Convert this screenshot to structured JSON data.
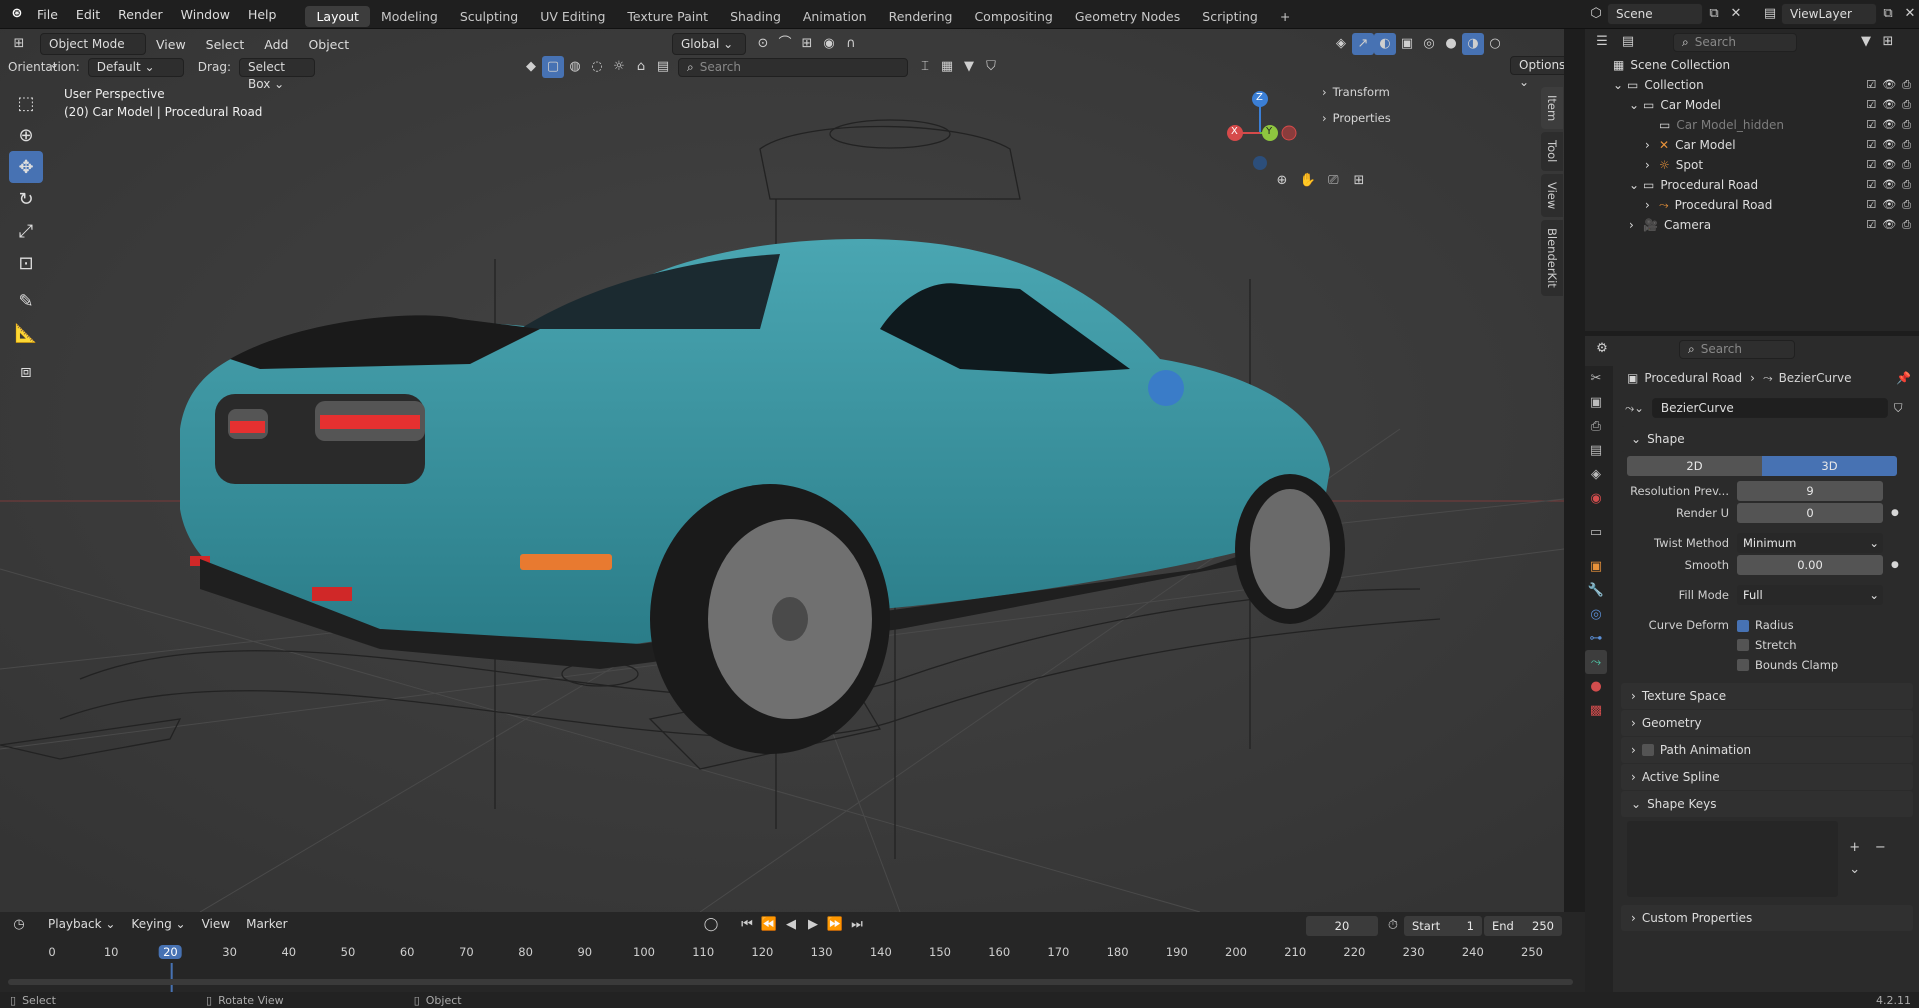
{
  "app": {
    "menus": [
      "File",
      "Edit",
      "Render",
      "Window",
      "Help"
    ],
    "workspaces": [
      "Layout",
      "Modeling",
      "Sculpting",
      "UV Editing",
      "Texture Paint",
      "Shading",
      "Animation",
      "Rendering",
      "Compositing",
      "Geometry Nodes",
      "Scripting"
    ],
    "active_workspace": "Layout",
    "scene": "Scene",
    "view_layer": "ViewLayer",
    "version": "4.2.11"
  },
  "viewport": {
    "mode": "Object Mode",
    "menus": [
      "View",
      "Select",
      "Add",
      "Object"
    ],
    "transform": "Global",
    "orientation_label": "Orientation:",
    "orientation": "Default",
    "drag_label": "Drag:",
    "drag": "Select Box",
    "search_placeholder": "Search",
    "options": "Options",
    "view_name": "User Perspective",
    "context": "(20) Car Model | Procedural Road",
    "npanel": {
      "sections": [
        "Transform",
        "Properties"
      ],
      "tabs": [
        "Item",
        "Tool",
        "View",
        "BlenderKit"
      ]
    },
    "gizmo": {
      "x": "X",
      "y": "Y",
      "z": "Z"
    }
  },
  "outliner": {
    "search_placeholder": "Search",
    "root": "Scene Collection",
    "rows": [
      {
        "label": "Collection",
        "depth": 0,
        "icon": "collection-icon",
        "expander": "⌄"
      },
      {
        "label": "Car Model",
        "depth": 1,
        "icon": "collection-icon",
        "expander": "⌄"
      },
      {
        "label": "Car Model_hidden",
        "depth": 2,
        "icon": "collection-icon",
        "expander": "",
        "dim": true
      },
      {
        "label": "Car Model",
        "depth": 2,
        "icon": "armature-icon",
        "expander": "›"
      },
      {
        "label": "Spot",
        "depth": 2,
        "icon": "light-icon",
        "expander": "›"
      },
      {
        "label": "Procedural Road",
        "depth": 1,
        "icon": "collection-icon",
        "expander": "⌄"
      },
      {
        "label": "Procedural Road",
        "depth": 2,
        "icon": "curve-icon",
        "expander": "›"
      },
      {
        "label": "Camera",
        "depth": 1,
        "icon": "camera-icon",
        "expander": "›"
      }
    ]
  },
  "properties": {
    "search_placeholder": "Search",
    "breadcrumb_object": "Procedural Road",
    "breadcrumb_data": "BezierCurve",
    "datablock": "BezierCurve",
    "shape": {
      "title": "Shape",
      "dim2": "2D",
      "dim3": "3D",
      "resolution_label": "Resolution Prev...",
      "resolution": "9",
      "render_u_label": "Render U",
      "render_u": "0",
      "twist_label": "Twist Method",
      "twist": "Minimum",
      "smooth_label": "Smooth",
      "smooth": "0.00",
      "fill_label": "Fill Mode",
      "fill": "Full",
      "deform_label": "Curve Deform",
      "radius": "Radius",
      "stretch": "Stretch",
      "bounds": "Bounds Clamp"
    },
    "sections": [
      "Texture Space",
      "Geometry",
      "Path Animation",
      "Active Spline"
    ],
    "shape_keys": "Shape Keys",
    "custom": "Custom Properties"
  },
  "timeline": {
    "menus": [
      "Playback",
      "Keying",
      "View",
      "Marker"
    ],
    "current": "20",
    "start_label": "Start",
    "start": "1",
    "end_label": "End",
    "end": "250",
    "ticks": [
      "0",
      "10",
      "20",
      "30",
      "40",
      "50",
      "60",
      "70",
      "80",
      "90",
      "100",
      "110",
      "120",
      "130",
      "140",
      "150",
      "160",
      "170",
      "180",
      "190",
      "200",
      "210",
      "220",
      "230",
      "240",
      "250"
    ]
  },
  "status": {
    "select": "Select",
    "rotate": "Rotate View",
    "object": "Object",
    "version": "4.2.11"
  }
}
